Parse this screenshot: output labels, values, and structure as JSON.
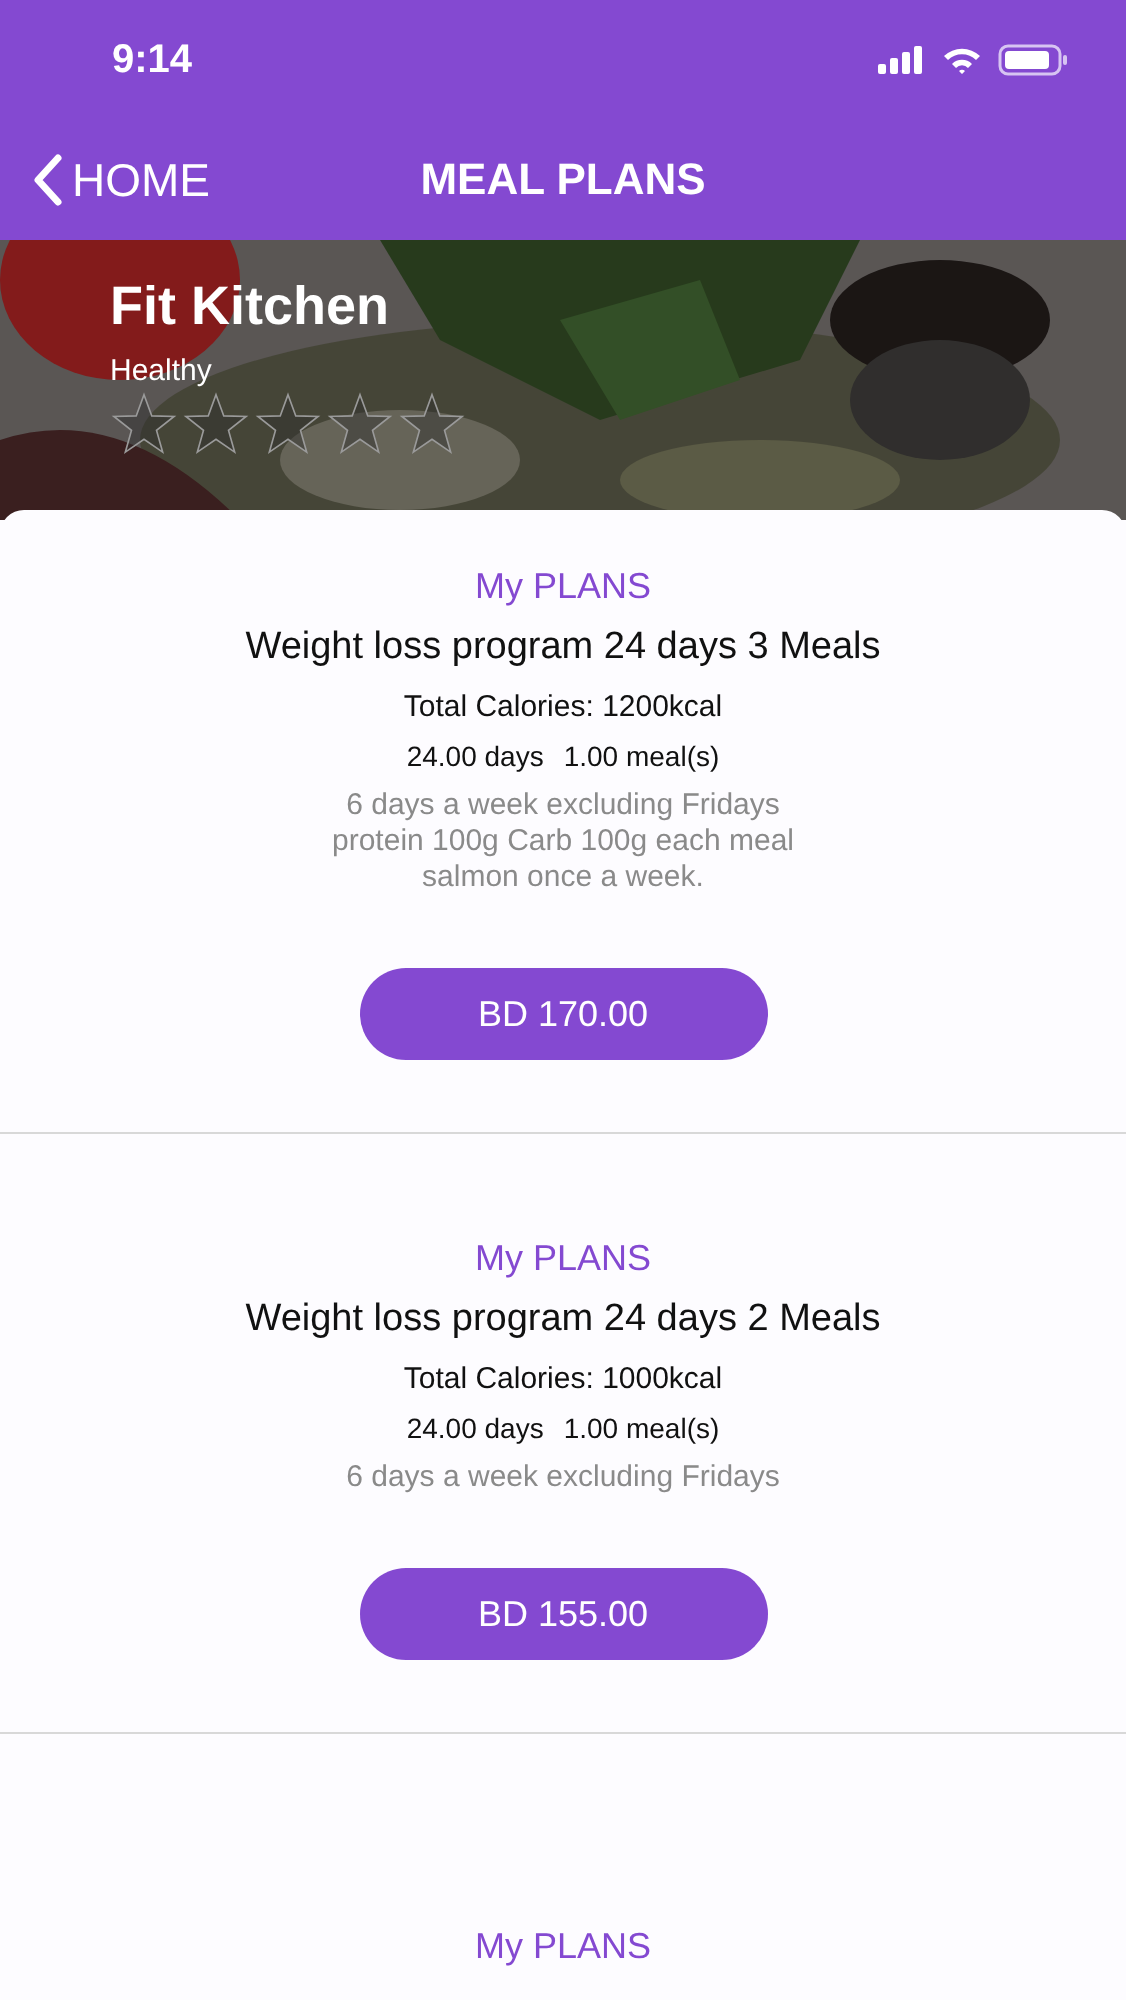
{
  "status_bar": {
    "time": "9:14"
  },
  "nav": {
    "back": "HOME",
    "title": "MEAL PLANS"
  },
  "restaurant": {
    "name": "Fit Kitchen",
    "category": "Healthy",
    "stars": 0
  },
  "plans": [
    {
      "section": "My PLANS",
      "title": "Weight loss program 24 days 3 Meals",
      "calories": "Total Calories: 1200kcal",
      "days": "24.00 days",
      "meals": "1.00 meal(s)",
      "description": "6 days a week excluding Fridays protein 100g Carb 100g each meal salmon once a week.",
      "price": "BD 170.00"
    },
    {
      "section": "My PLANS",
      "title": "Weight loss program 24 days 2 Meals",
      "calories": "Total Calories: 1000kcal",
      "days": "24.00 days",
      "meals": "1.00 meal(s)",
      "description": "6 days a week excluding Fridays",
      "price": "BD 155.00"
    },
    {
      "section": "My PLANS"
    }
  ]
}
